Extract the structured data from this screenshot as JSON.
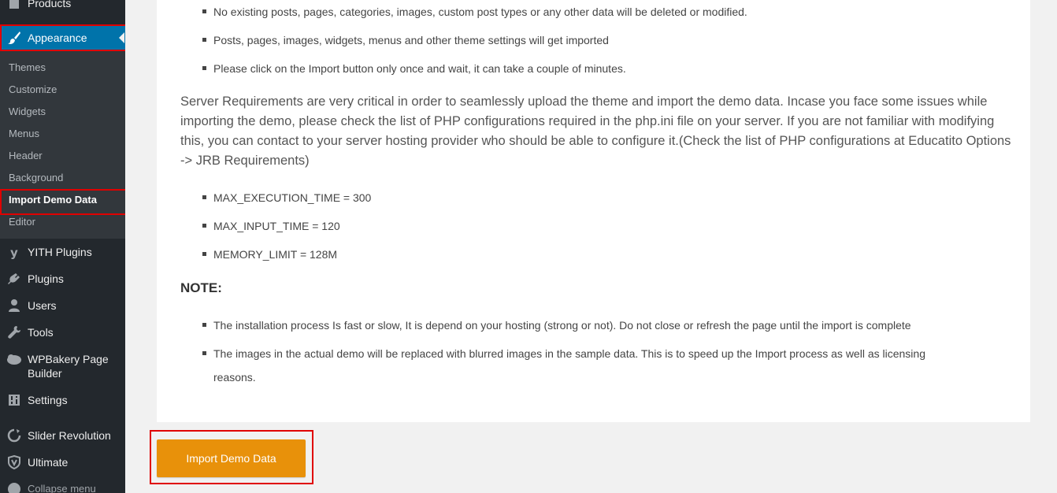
{
  "sidebar": {
    "products_label": "Products",
    "appearance_label": "Appearance",
    "submenu": [
      "Themes",
      "Customize",
      "Widgets",
      "Menus",
      "Header",
      "Background",
      "Import Demo Data",
      "Editor"
    ],
    "menu": {
      "yith": "YITH Plugins",
      "plugins": "Plugins",
      "users": "Users",
      "tools": "Tools",
      "wpbakery_line1": "WPBakery Page",
      "wpbakery_line2": "Builder",
      "settings": "Settings",
      "slider": "Slider Revolution",
      "ultimate": "Ultimate",
      "collapse": "Collapse menu"
    },
    "colors": {
      "background": "#23282d",
      "submenu_bg": "#32373c",
      "active": "#0073aa",
      "highlight": "#e00000"
    }
  },
  "content": {
    "intro_bullets": [
      "No existing posts, pages, categories, images, custom post types or any other data will be deleted or modified.",
      "Posts, pages, images, widgets, menus and other theme settings will get imported",
      "Please click on the Import button only once and wait, it can take a couple of minutes."
    ],
    "server_paragraph": "Server Requirements are very critical in order to seamlessly upload the theme and import the demo data. Incase you face some issues while importing the demo, please check the list of PHP configurations required in the php.ini file on your server. If you are not familiar with modifying this, you can contact to your server hosting provider who should be able to configure it.(Check the list of PHP configurations at Educatito Options -> JRB Requirements)",
    "requirements": [
      "MAX_EXECUTION_TIME = 300",
      "MAX_INPUT_TIME = 120",
      "MEMORY_LIMIT = 128M"
    ],
    "note_heading": "NOTE:",
    "note_bullets": [
      "The installation process Is fast or slow, It is depend on your hosting (strong or not). Do not close or refresh the page until the import is complete",
      "The images in the actual demo will be replaced with blurred images in the sample data. This is to speed up the Import process as well as licensing",
      "reasons."
    ]
  },
  "import_button": {
    "label": "Import Demo Data",
    "color": "#e8910a"
  }
}
